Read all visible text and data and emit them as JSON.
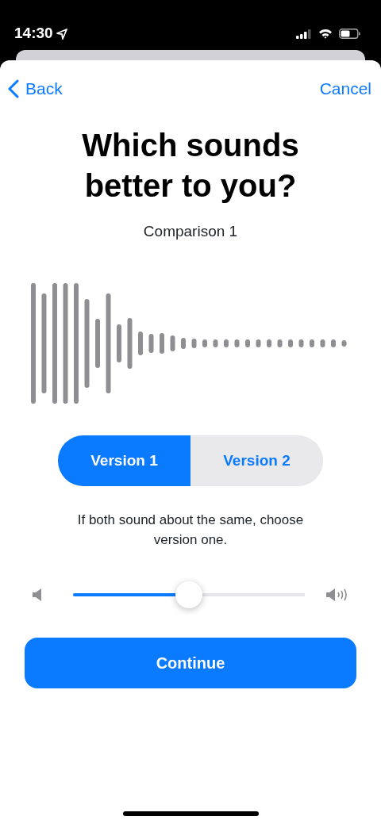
{
  "status_bar": {
    "time": "14:30"
  },
  "nav": {
    "back": "Back",
    "cancel": "Cancel"
  },
  "title": "Which sounds better to you?",
  "subtitle": "Comparison 1",
  "versions": [
    {
      "label": "Version 1",
      "selected": true
    },
    {
      "label": "Version 2",
      "selected": false
    }
  ],
  "hint": "If both sound about the same, choose version one.",
  "volume": {
    "level": 0.5
  },
  "continue_button": "Continue"
}
